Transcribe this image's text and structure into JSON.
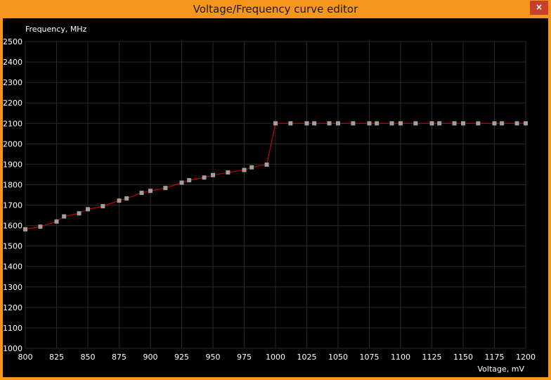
{
  "window": {
    "title": "Voltage/Frequency curve editor",
    "close_label": "×"
  },
  "colors": {
    "frame": "#f7961c",
    "background": "#000000",
    "grid": "#2a2a2a",
    "curve": "#e00000",
    "point": "#a0a0a0",
    "text": "#ffffff",
    "close_button": "#c7402b"
  },
  "chart_data": {
    "type": "line",
    "title": "",
    "xlabel": "Voltage, mV",
    "ylabel": "Frequency, MHz",
    "xlim": [
      800,
      1200
    ],
    "ylim": [
      1000,
      2500
    ],
    "grid": true,
    "x_ticks": [
      800,
      825,
      850,
      875,
      900,
      925,
      950,
      975,
      1000,
      1025,
      1050,
      1075,
      1100,
      1125,
      1150,
      1175,
      1200
    ],
    "y_ticks": [
      1000,
      1100,
      1200,
      1300,
      1400,
      1500,
      1600,
      1700,
      1800,
      1900,
      2000,
      2100,
      2200,
      2300,
      2400,
      2500
    ],
    "series": [
      {
        "points": [
          [
            800,
            1582
          ],
          [
            812,
            1595
          ],
          [
            825,
            1620
          ],
          [
            831,
            1645
          ],
          [
            843,
            1660
          ],
          [
            850,
            1680
          ],
          [
            862,
            1695
          ],
          [
            875,
            1722
          ],
          [
            881,
            1733
          ],
          [
            893,
            1760
          ],
          [
            900,
            1770
          ],
          [
            912,
            1784
          ],
          [
            925,
            1810
          ],
          [
            931,
            1822
          ],
          [
            943,
            1835
          ],
          [
            950,
            1847
          ],
          [
            962,
            1860
          ],
          [
            975,
            1872
          ],
          [
            981,
            1885
          ],
          [
            993,
            1898
          ],
          [
            1000,
            2100
          ],
          [
            1012,
            2100
          ],
          [
            1025,
            2100
          ],
          [
            1031,
            2100
          ],
          [
            1043,
            2100
          ],
          [
            1050,
            2100
          ],
          [
            1062,
            2100
          ],
          [
            1075,
            2100
          ],
          [
            1081,
            2100
          ],
          [
            1093,
            2100
          ],
          [
            1100,
            2100
          ],
          [
            1112,
            2100
          ],
          [
            1125,
            2100
          ],
          [
            1131,
            2100
          ],
          [
            1143,
            2100
          ],
          [
            1150,
            2100
          ],
          [
            1162,
            2100
          ],
          [
            1175,
            2100
          ],
          [
            1181,
            2100
          ],
          [
            1193,
            2100
          ],
          [
            1200,
            2100
          ]
        ]
      }
    ]
  }
}
